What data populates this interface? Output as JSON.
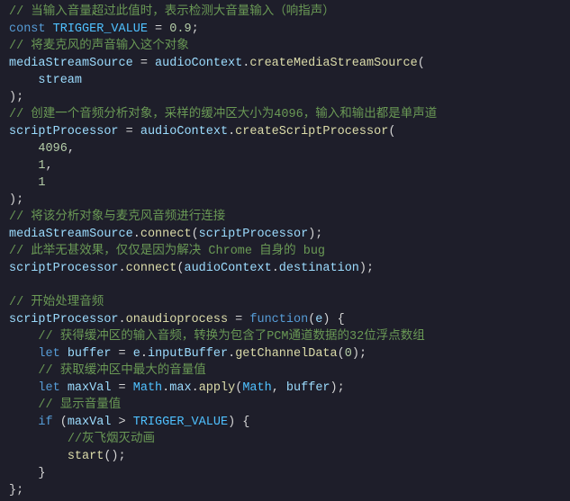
{
  "code": {
    "c1": "// 当输入音量超过此值时，表示检测大音量输入（响指声）",
    "l2_const": "const",
    "l2_name": "TRIGGER_VALUE",
    "l2_eq": " = ",
    "l2_val": "0.9",
    "l2_semi": ";",
    "c2": "// 将麦克风的声音输入这个对象",
    "l4_a": "mediaStreamSource",
    "l4_eq": " = ",
    "l4_b": "audioContext",
    "l4_dot": ".",
    "l4_fn": "createMediaStreamSource",
    "l4_open": "(",
    "l5_arg": "stream",
    "l6_close": ");",
    "c3": "// 创建一个音频分析对象，采样的缓冲区大小为4096，输入和输出都是单声道",
    "l8_a": "scriptProcessor",
    "l8_eq": " = ",
    "l8_b": "audioContext",
    "l8_dot": ".",
    "l8_fn": "createScriptProcessor",
    "l8_open": "(",
    "l9_v": "4096",
    "l9_comma": ",",
    "l10_v": "1",
    "l10_comma": ",",
    "l11_v": "1",
    "l12_close": ");",
    "c4": "// 将该分析对象与麦克风音频进行连接",
    "l14_a": "mediaStreamSource",
    "l14_dot": ".",
    "l14_fn": "connect",
    "l14_open": "(",
    "l14_arg": "scriptProcessor",
    "l14_close": ");",
    "c5": "// 此举无甚效果，仅仅是因为解决 Chrome 自身的 bug",
    "l16_a": "scriptProcessor",
    "l16_dot1": ".",
    "l16_fn": "connect",
    "l16_open": "(",
    "l16_b": "audioContext",
    "l16_dot2": ".",
    "l16_c": "destination",
    "l16_close": ");",
    "c6": "// 开始处理音频",
    "l18_a": "scriptProcessor",
    "l18_dot": ".",
    "l18_b": "onaudioprocess",
    "l18_eq": " = ",
    "l18_kw": "function",
    "l18_open": "(",
    "l18_param": "e",
    "l18_close": ") {",
    "c7": "// 获得缓冲区的输入音频，转换为包含了PCM通道数据的32位浮点数组",
    "l20_let": "let",
    "l20_name": "buffer",
    "l20_eq": " = ",
    "l20_a": "e",
    "l20_dot1": ".",
    "l20_b": "inputBuffer",
    "l20_dot2": ".",
    "l20_fn": "getChannelData",
    "l20_open": "(",
    "l20_arg": "0",
    "l20_close": ");",
    "c8": "// 获取缓冲区中最大的音量值",
    "l22_let": "let",
    "l22_name": "maxVal",
    "l22_eq": " = ",
    "l22_a": "Math",
    "l22_dot1": ".",
    "l22_b": "max",
    "l22_dot2": ".",
    "l22_fn": "apply",
    "l22_open": "(",
    "l22_arg1": "Math",
    "l22_comma": ", ",
    "l22_arg2": "buffer",
    "l22_close": ");",
    "c9": "// 显示音量值",
    "l24_if": "if",
    "l24_open": " (",
    "l24_a": "maxVal",
    "l24_op": " > ",
    "l24_b": "TRIGGER_VALUE",
    "l24_close": ") {",
    "c10": "//灰飞烟灭动画",
    "l26_fn": "start",
    "l26_call": "();",
    "l27_close": "}",
    "l28_close": "};"
  }
}
